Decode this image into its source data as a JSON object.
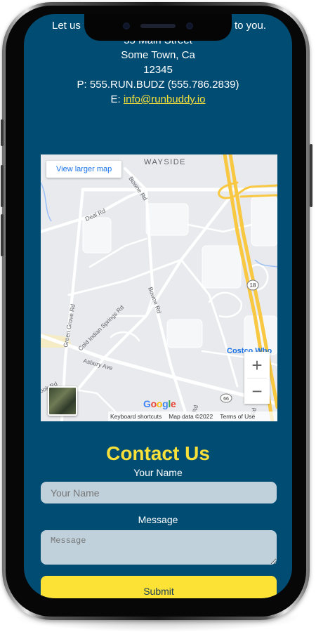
{
  "address": {
    "intro_partial_left": "Let us",
    "intro_partial_right": "to you.",
    "street": "55 Main Street",
    "city": "Some Town, Ca",
    "zip": "12345",
    "phone": "P: 555.RUN.BUDZ (555.786.2839)",
    "email_prefix": "E:",
    "email": "info@runbuddy.io"
  },
  "map": {
    "view_larger": "View larger map",
    "place_label": "WAYSIDE",
    "road_labels": [
      "Deal Rd",
      "Bowne Rd",
      "Bowne Rd",
      "Green Grove Rd",
      "Cold Indian Springs Rd",
      "Asbury Ave",
      "Rd",
      "Rd",
      "ook Rd"
    ],
    "poi_label": "Costco Who",
    "route_18": "18",
    "route_66": "66",
    "zoom_in": "+",
    "zoom_out": "−",
    "google_logo": "Google",
    "keyboard_shortcuts": "Keyboard shortcuts",
    "map_data": "Map data ©2022",
    "terms": "Terms of Use"
  },
  "contact": {
    "title": "Contact Us",
    "name_label": "Your Name",
    "name_placeholder": "Your Name",
    "message_label": "Message",
    "message_placeholder": "Message",
    "submit_label": "Submit"
  },
  "colors": {
    "background": "#004c73",
    "accent": "#f7e03a",
    "input": "#c0d1dc",
    "button": "#fde236"
  }
}
